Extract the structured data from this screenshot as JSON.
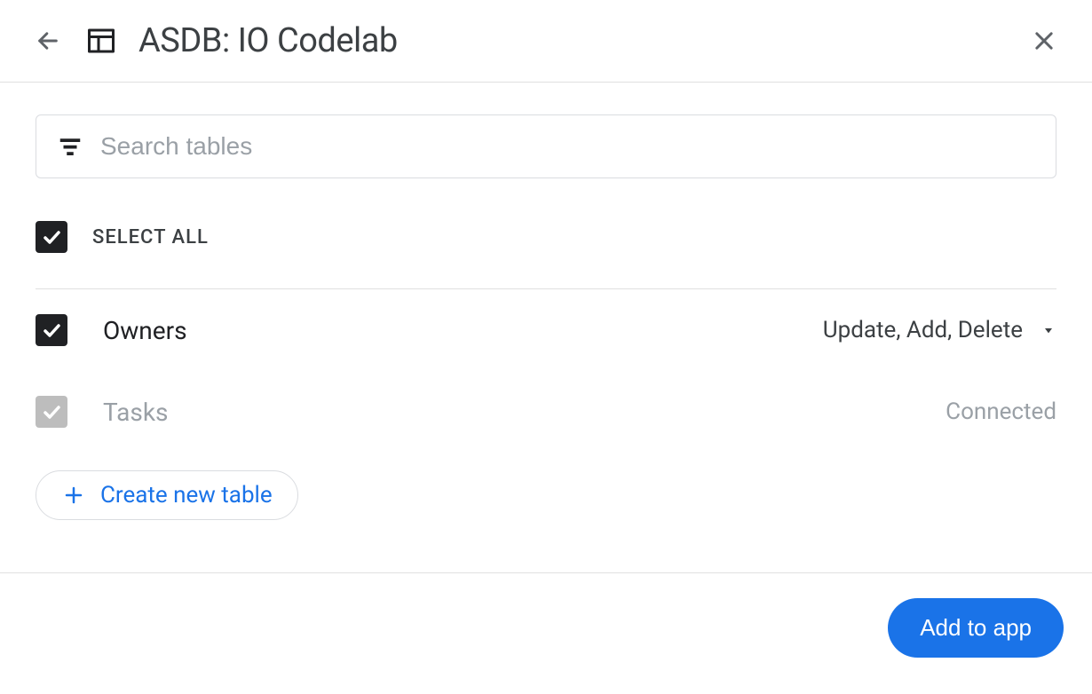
{
  "header": {
    "title": "ASDB: IO Codelab"
  },
  "search": {
    "placeholder": "Search tables"
  },
  "select_all": {
    "label": "SELECT ALL"
  },
  "tables": [
    {
      "name": "Owners",
      "status": "Update, Add, Delete",
      "checked": true,
      "muted": false,
      "has_dropdown": true
    },
    {
      "name": "Tasks",
      "status": "Connected",
      "checked": true,
      "muted": true,
      "has_dropdown": false
    }
  ],
  "create_new": {
    "label": "Create new table"
  },
  "footer": {
    "add_label": "Add to app"
  },
  "colors": {
    "primary": "#1a73e8",
    "text": "#202124",
    "muted": "#9aa0a6"
  }
}
